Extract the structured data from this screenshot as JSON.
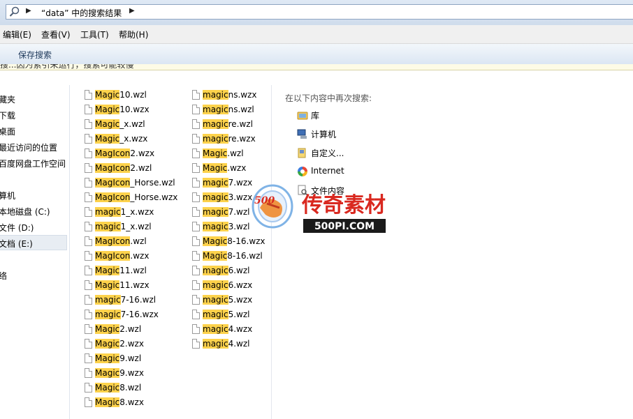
{
  "address": {
    "search_icon": "search-icon",
    "path_label": "“data” 中的搜索结果"
  },
  "menu": [
    "编辑(E)",
    "查看(V)",
    "工具(T)",
    "帮助(H)"
  ],
  "toolbar": {
    "save_search": "保存搜索"
  },
  "infobar": {
    "text": "搜...因为索引未运行，搜索可能较慢"
  },
  "nav": {
    "items": [
      "藏夹",
      "下载",
      "桌面",
      "最近访问的位置",
      "百度网盘工作空间",
      "算机",
      "本地磁盘 (C:)",
      "文件 (D:)",
      "文档 (E:)",
      "络"
    ],
    "selected_index": 8
  },
  "files": {
    "column1": [
      {
        "match": "Magic",
        "rest": "10.wzl"
      },
      {
        "match": "Magic",
        "rest": "10.wzx"
      },
      {
        "match": "Magic",
        "rest": "_x.wzl"
      },
      {
        "match": "Magic",
        "rest": "_x.wzx"
      },
      {
        "match": "MagIcon",
        "rest": "2.wzx"
      },
      {
        "match": "MagIcon",
        "rest": "2.wzl"
      },
      {
        "match": "MagIcon",
        "rest": "_Horse.wzl"
      },
      {
        "match": "MagIcon",
        "rest": "_Horse.wzx"
      },
      {
        "match": "magic",
        "rest": "1_x.wzx"
      },
      {
        "match": "magic",
        "rest": "1_x.wzl"
      },
      {
        "match": "MagIcon",
        "rest": ".wzl"
      },
      {
        "match": "MagIcon",
        "rest": ".wzx"
      },
      {
        "match": "Magic",
        "rest": "11.wzl"
      },
      {
        "match": "Magic",
        "rest": "11.wzx"
      },
      {
        "match": "magic",
        "rest": "7-16.wzl"
      },
      {
        "match": "magic",
        "rest": "7-16.wzx"
      },
      {
        "match": "Magic",
        "rest": "2.wzl"
      },
      {
        "match": "Magic",
        "rest": "2.wzx"
      },
      {
        "match": "Magic",
        "rest": "9.wzl"
      },
      {
        "match": "Magic",
        "rest": "9.wzx"
      },
      {
        "match": "Magic",
        "rest": "8.wzl"
      },
      {
        "match": "Magic",
        "rest": "8.wzx"
      }
    ],
    "column2": [
      {
        "match": "magic",
        "rest": "ns.wzx"
      },
      {
        "match": "magic",
        "rest": "ns.wzl"
      },
      {
        "match": "magic",
        "rest": "re.wzl"
      },
      {
        "match": "magic",
        "rest": "re.wzx"
      },
      {
        "match": "Magic",
        "rest": ".wzl"
      },
      {
        "match": "Magic",
        "rest": ".wzx"
      },
      {
        "match": "magic",
        "rest": "7.wzx"
      },
      {
        "match": "magic",
        "rest": "3.wzx"
      },
      {
        "match": "magic",
        "rest": "7.wzl"
      },
      {
        "match": "magic",
        "rest": "3.wzl"
      },
      {
        "match": "Magic",
        "rest": "8-16.wzx"
      },
      {
        "match": "Magic",
        "rest": "8-16.wzl"
      },
      {
        "match": "magic",
        "rest": "6.wzl"
      },
      {
        "match": "magic",
        "rest": "6.wzx"
      },
      {
        "match": "magic",
        "rest": "5.wzx"
      },
      {
        "match": "magic",
        "rest": "5.wzl"
      },
      {
        "match": "magic",
        "rest": "4.wzx"
      },
      {
        "match": "magic",
        "rest": "4.wzl"
      }
    ]
  },
  "search_again": {
    "heading": "在以下内容中再次搜索:",
    "options": [
      {
        "label": "库",
        "icon": "library-icon"
      },
      {
        "label": "计算机",
        "icon": "computer-icon"
      },
      {
        "label": "自定义...",
        "icon": "custom-folder-icon"
      },
      {
        "label": "Internet",
        "icon": "internet-icon"
      },
      {
        "label": "文件内容",
        "icon": "file-contents-icon"
      }
    ]
  },
  "watermark": {
    "logo_icon": "500pi-logo-icon",
    "title": "传奇素材",
    "url": "500PI.COM"
  },
  "colors": {
    "highlight": "#fdd24b",
    "toolbar_text": "#1e395b"
  }
}
